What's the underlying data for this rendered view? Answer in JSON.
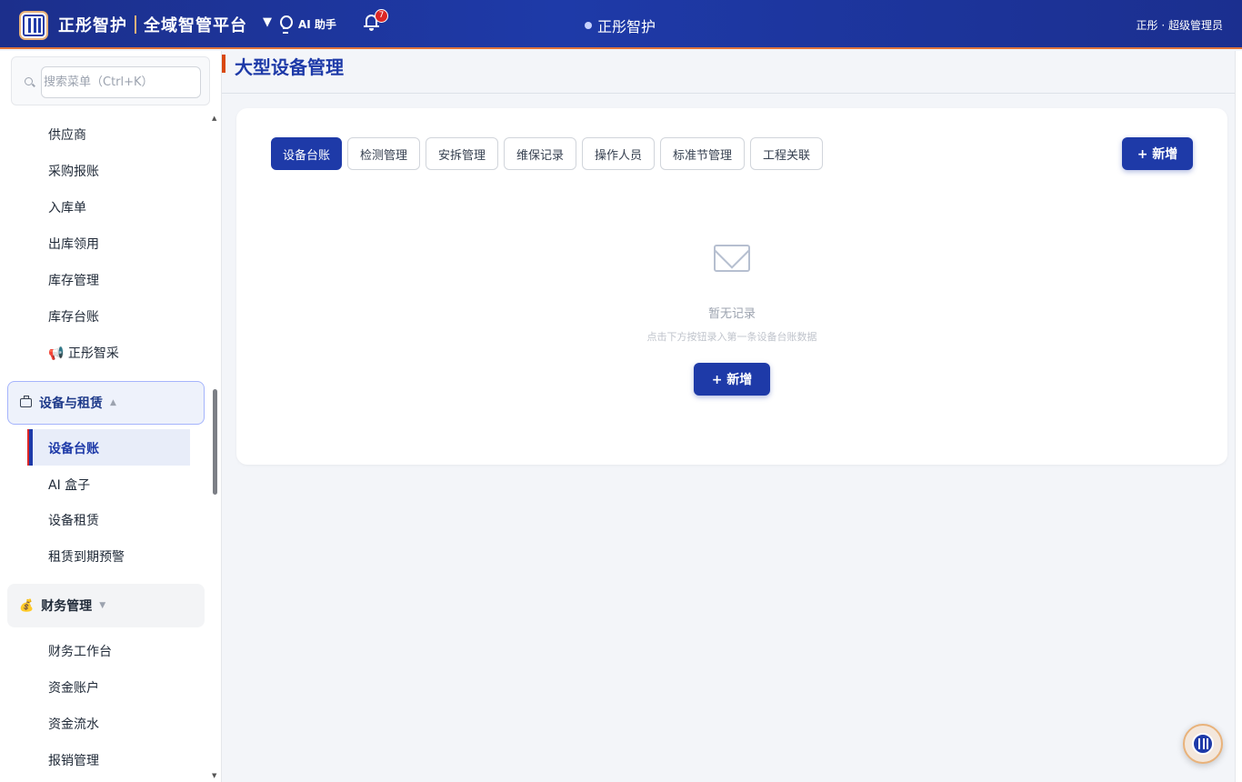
{
  "header": {
    "brand": "正彤智护",
    "platform": "全域智管平台",
    "caret": "▼",
    "ai_label": "AI 助手",
    "notification_count": "7",
    "center_title": "正彤智护",
    "user": "正彤 · 超级管理员"
  },
  "sidebar": {
    "search_placeholder": "搜索菜单（Ctrl+K）",
    "purchase_items": [
      "供应商",
      "采购报账",
      "入库单",
      "出库领用",
      "库存管理",
      "库存台账",
      "📢 正彤智采"
    ],
    "equipment_group": {
      "label": "设备与租赁",
      "caret": "▲"
    },
    "equipment_items": {
      "active": "设备台账",
      "others": [
        "AI 盒子",
        "设备租赁",
        "租赁到期预警"
      ]
    },
    "finance_group": {
      "label": "财务管理",
      "icon": "💰",
      "caret": "▼"
    },
    "finance_items": [
      "财务工作台",
      "资金账户",
      "资金流水",
      "报销管理"
    ]
  },
  "main": {
    "page_title": "大型设备管理",
    "tabs": [
      "设备台账",
      "检测管理",
      "安拆管理",
      "维保记录",
      "操作人员",
      "标准节管理",
      "工程关联"
    ],
    "add_button": "+ 新增",
    "empty": {
      "title": "暂无记录",
      "subtitle": "点击下方按钮录入第一条设备台账数据",
      "button": "+ 新增"
    }
  },
  "colors": {
    "primary": "#1e3aa8",
    "accent": "#d9480f",
    "badge": "#dc2626"
  }
}
